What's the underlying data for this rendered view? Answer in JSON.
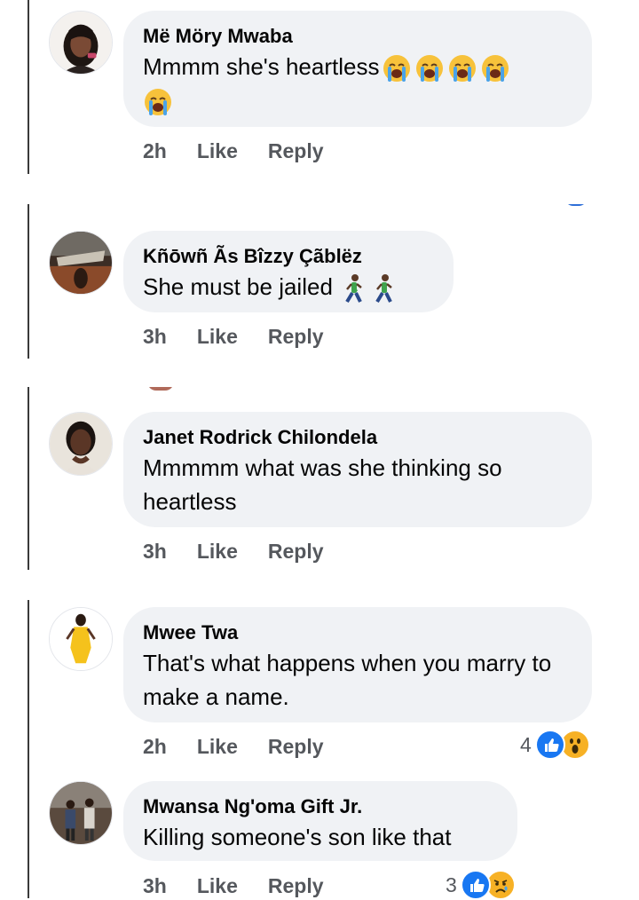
{
  "comments": [
    {
      "name": "Më Möry Mwaba",
      "text": "Mmmm she's heartless",
      "emoji": [
        "loudly-crying-face",
        "loudly-crying-face",
        "loudly-crying-face",
        "loudly-crying-face",
        "loudly-crying-face"
      ],
      "time": "2h",
      "like": "Like",
      "reply": "Reply"
    },
    {
      "name": "Kñōwñ Ãs Bîzzy Çãblëz",
      "text": "She must be jailed",
      "emoji": [
        "person-walking",
        "person-walking"
      ],
      "time": "3h",
      "like": "Like",
      "reply": "Reply"
    },
    {
      "name": "Janet Rodrick Chilondela",
      "text": "Mmmmm what was she thinking so heartless",
      "time": "3h",
      "like": "Like",
      "reply": "Reply"
    },
    {
      "name": "Mwee Twa",
      "text": "That's what happens when you marry to make a name.",
      "time": "2h",
      "like": "Like",
      "reply": "Reply",
      "reaction_count": "4",
      "reaction_icons": [
        "like-icon",
        "wow-icon"
      ]
    },
    {
      "name": "Mwansa Ng'oma Gift Jr.",
      "text": "Killing someone's son like that",
      "time": "3h",
      "like": "Like",
      "reply": "Reply",
      "reaction_count": "3",
      "reaction_icons": [
        "like-icon",
        "sad-icon"
      ]
    }
  ],
  "colors": {
    "bubble": "#f0f2f5",
    "meta_text": "#55585d",
    "like_blue": "#1877f2",
    "reaction_yellow": "#f7b125"
  }
}
